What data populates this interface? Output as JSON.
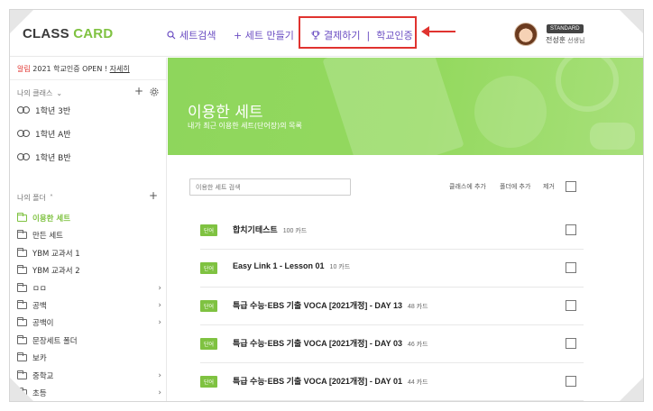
{
  "header": {
    "logo_part1": "CLASS",
    "logo_part2": "CARD",
    "nav": {
      "search": "세트검색",
      "make": "+ 세트 만들기",
      "pay": "결제하기",
      "school": "학교인증",
      "separator": "|"
    },
    "user": {
      "plan_badge": "STANDARD",
      "name": "전성훈",
      "role": "선생님"
    }
  },
  "sidebar": {
    "notice": {
      "tag": "알림",
      "text": "2021 학교인증 OPEN !",
      "link": "자세히"
    },
    "class_section_title": "나의 클래스",
    "classes": [
      "1학년 3반",
      "1학년 A반",
      "1학년 B반"
    ],
    "folder_section_title": "나의 폴더",
    "folders": [
      {
        "label": "이용한 세트",
        "active": true,
        "has_children": false
      },
      {
        "label": "만든 세트",
        "active": false,
        "has_children": false
      },
      {
        "label": "YBM 교과서 1",
        "active": false,
        "has_children": false
      },
      {
        "label": "YBM 교과서 2",
        "active": false,
        "has_children": false
      },
      {
        "label": "ㅁㅁ",
        "active": false,
        "has_children": true
      },
      {
        "label": "공백",
        "active": false,
        "has_children": true
      },
      {
        "label": "공백이",
        "active": false,
        "has_children": true
      },
      {
        "label": "문장세트 폴더",
        "active": false,
        "has_children": false
      },
      {
        "label": "보카",
        "active": false,
        "has_children": false
      },
      {
        "label": "중학교",
        "active": false,
        "has_children": true
      },
      {
        "label": "초등",
        "active": false,
        "has_children": true
      }
    ]
  },
  "main": {
    "hero_title": "이용한 세트",
    "hero_subtitle": "내가 최근 이용한 세트(단어장)의 목록",
    "search_placeholder": "이용한 세트 검색",
    "actions": {
      "add_class": "클래스에 추가",
      "add_folder": "폴더에 추가",
      "remove": "제거"
    },
    "sets": [
      {
        "tag": "단어",
        "title": "합치기테스트",
        "count": "100 카드"
      },
      {
        "tag": "단어",
        "title": "Easy Link 1 - Lesson 01",
        "count": "10 카드"
      },
      {
        "tag": "단어",
        "title": "특급 수능·EBS 기출 VOCA [2021개정] - DAY 13",
        "count": "48 카드"
      },
      {
        "tag": "단어",
        "title": "특급 수능·EBS 기출 VOCA [2021개정] - DAY 03",
        "count": "46 카드"
      },
      {
        "tag": "단어",
        "title": "특급 수능·EBS 기출 VOCA [2021개정] - DAY 01",
        "count": "44 카드"
      }
    ]
  },
  "colors": {
    "brand_green": "#7fc241",
    "nav_purple": "#6a4cc2",
    "annotation_red": "#e0332f"
  }
}
